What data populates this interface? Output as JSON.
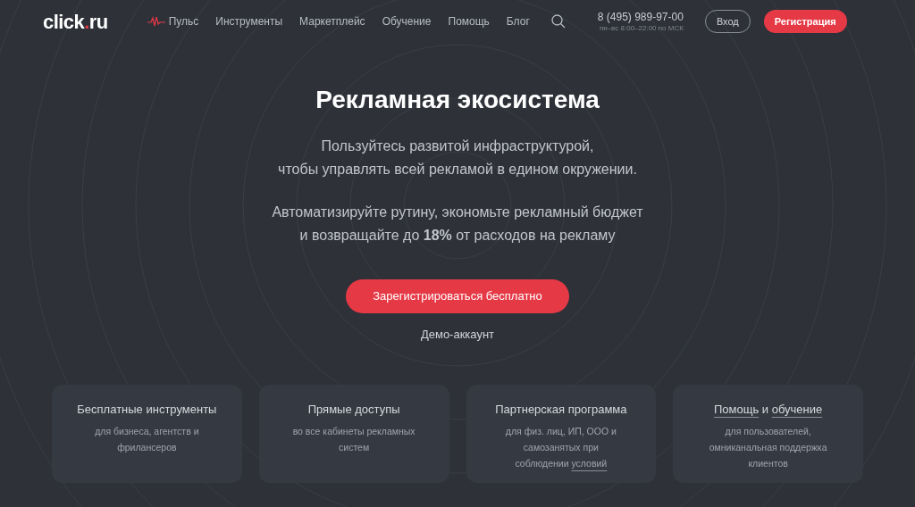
{
  "header": {
    "logo": {
      "main": "click",
      "accent": ".",
      "tail": "ru"
    },
    "nav": [
      {
        "label": "Пульс",
        "kind": "pulse"
      },
      {
        "label": "Инструменты",
        "kind": "plain"
      },
      {
        "label": "Маркетплейс",
        "kind": "plain"
      },
      {
        "label": "Обучение",
        "kind": "plain"
      },
      {
        "label": "Помощь",
        "kind": "plain"
      },
      {
        "label": "Блог",
        "kind": "plain"
      }
    ],
    "phone": "8 (495) 989-97-00",
    "hours": "пн–вс 8:00–22:00 по МСК",
    "login": "Вход",
    "register": "Регистрация"
  },
  "hero": {
    "title": "Рекламная экосистема",
    "paragraphs": [
      [
        "Пользуйтесь развитой инфраструктурой,",
        "чтобы управлять всей рекламой в едином окружении."
      ],
      [
        "Автоматизируйте рутину, экономьте рекламный бюджет",
        "и возвращайте до **18%** от расходов на рекламу"
      ]
    ],
    "cta": "Зарегистрироваться бесплатно",
    "demo": "Демо-аккаунт"
  },
  "cards": [
    {
      "title": [
        {
          "text": "Бесплатные инструменты",
          "link": false
        }
      ],
      "description": [
        {
          "text": "для бизнеса, агентств и фрилансеров",
          "link": false
        }
      ]
    },
    {
      "title": [
        {
          "text": "Прямые доступы",
          "link": false
        }
      ],
      "description": [
        {
          "text": "во все кабинеты рекламных систем",
          "link": false
        }
      ]
    },
    {
      "title": [
        {
          "text": "Партнерская программа",
          "link": false
        }
      ],
      "description": [
        {
          "text": "для физ. лиц, ИП, ООО и самозанятых при соблюдении",
          "link": false
        },
        {
          "text": "условий",
          "link": true
        }
      ]
    },
    {
      "title": [
        {
          "text": "Помощь",
          "link": true
        },
        {
          "text": "и",
          "link": false
        },
        {
          "text": "обучение",
          "link": true
        }
      ],
      "description": [
        {
          "text": "для пользователей, омниканальная поддержка клиентов",
          "link": false
        }
      ]
    }
  ]
}
